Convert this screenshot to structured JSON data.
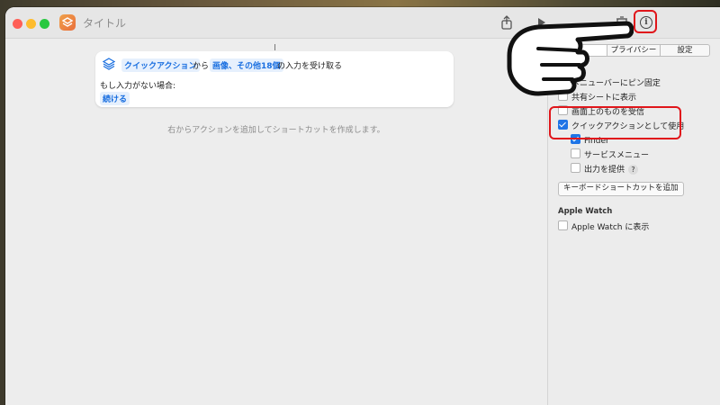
{
  "window": {
    "title": "タイトル"
  },
  "editor": {
    "action_card": {
      "chip_quick_action": "クイックアクション",
      "text_from": "から",
      "chip_inputs": "画像、その他18個",
      "text_receive": "の入力を受け取る",
      "no_input_label": "もし入力がない場合:",
      "continue_label": "続ける"
    },
    "hint": "右からアクションを追加してショートカットを作成します。"
  },
  "sidebar": {
    "tabs": [
      {
        "label": ""
      },
      {
        "label": "プライバシー"
      },
      {
        "label": "設定"
      }
    ],
    "options": [
      {
        "label": "メニューバーにピン固定",
        "checked": false
      },
      {
        "label": "共有シートに表示",
        "checked": false
      },
      {
        "label": "画面上のものを受信",
        "checked": false
      },
      {
        "label": "クイックアクションとして使用",
        "checked": true
      },
      {
        "label": "Finder",
        "checked": true
      },
      {
        "label": "サービスメニュー",
        "checked": false
      },
      {
        "label": "出力を提供",
        "checked": false
      }
    ],
    "help_label": "?",
    "keyboard_shortcut_button": "キーボードショートカットを追加",
    "apple_watch_heading": "Apple Watch",
    "apple_watch_option": {
      "label": "Apple Watch に表示",
      "checked": false
    }
  },
  "colors": {
    "accent": "#1f74e6",
    "highlight": "#e0161b",
    "chip_text": "#1a6fe0"
  },
  "icons": [
    "share-icon",
    "play-icon",
    "trash-icon",
    "info-icon",
    "shortcut-app-icon",
    "pointing-hand-icon"
  ]
}
